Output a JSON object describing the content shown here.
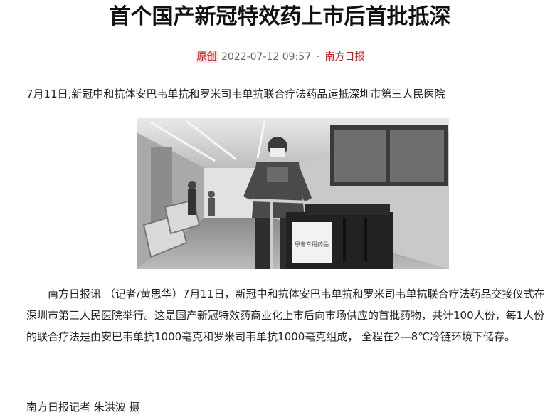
{
  "article": {
    "title": "首个国产新冠特效药上市后首批抵深",
    "meta": {
      "tag": "原创",
      "datetime": "2022-07-12 09:57",
      "separator": "·",
      "source": "南方日报"
    },
    "photo_caption": "7月11日,新冠中和抗体安巴韦单抗和罗米司韦单抗联合疗法药品运抵深圳市第三人民医院",
    "photo": {
      "description_icon": "photo-image",
      "box_label": "患者专用药品"
    },
    "body": "南方日报讯 （记者/黄思华）7月11日，新冠中和抗体安巴韦单抗和罗米司韦单抗联合疗法药品交接仪式在深圳市第三人民医院举行。这是国产新冠特效药商业化上市后向市场供应的首批药物，共计100人份，每1人份的联合疗法是由安巴韦单抗1000毫克和罗米司韦单抗1000毫克组成， 全程在2—8℃冷链环境下储存。",
    "credit": "南方日报记者 朱洪波 摄"
  },
  "colors": {
    "accent": "#c8161d",
    "tag_bg": "#fde2e2",
    "meta_text": "#666666"
  }
}
